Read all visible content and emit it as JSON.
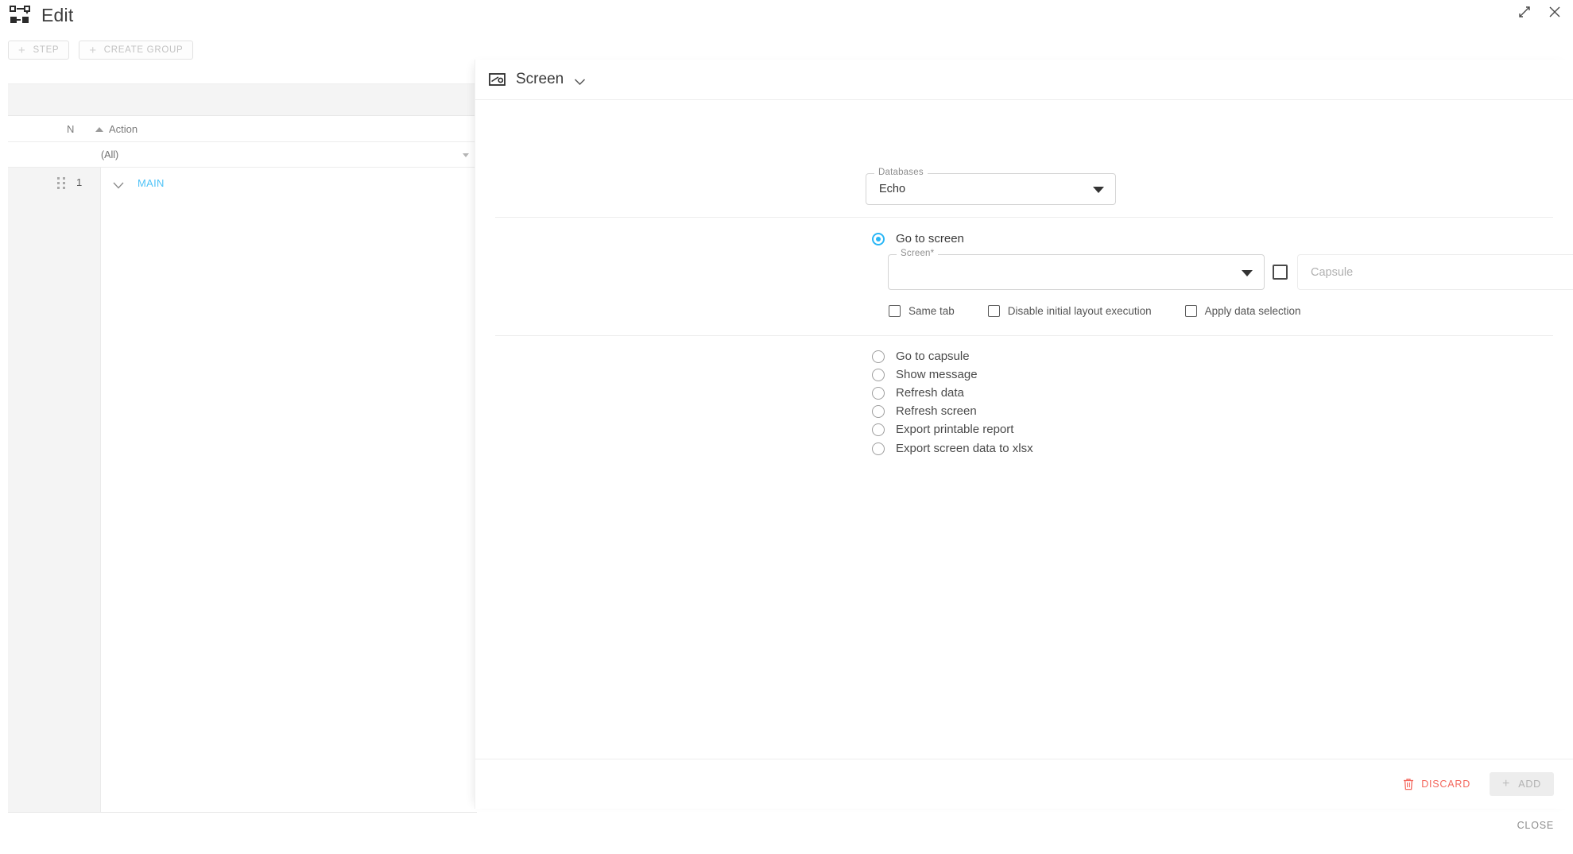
{
  "header": {
    "title": "Edit",
    "icon": "flow-diagram-icon",
    "expand_icon": "expand-icon",
    "close_icon": "close-icon"
  },
  "toolbar": {
    "step_label": "STEP",
    "create_group_label": "CREATE GROUP",
    "plus": "+"
  },
  "list": {
    "columns": {
      "n": "N",
      "action": "Action"
    },
    "filter_value": "(All)",
    "rows": [
      {
        "num": "1",
        "label": "MAIN",
        "label_color": "#4fc3f7"
      }
    ]
  },
  "detail": {
    "title": "Screen",
    "icon": "screen-icon",
    "databases": {
      "legend": "Databases",
      "value": "Echo"
    },
    "options": [
      {
        "id": "go-to-screen",
        "label": "Go to screen",
        "selected": true
      },
      {
        "id": "go-to-capsule",
        "label": "Go to capsule",
        "selected": false
      },
      {
        "id": "show-message",
        "label": "Show message",
        "selected": false
      },
      {
        "id": "refresh-data",
        "label": "Refresh data",
        "selected": false
      },
      {
        "id": "refresh-screen",
        "label": "Refresh screen",
        "selected": false
      },
      {
        "id": "export-printable-report",
        "label": "Export printable report",
        "selected": false
      },
      {
        "id": "export-screen-data-to-xlsx",
        "label": "Export screen data to xlsx",
        "selected": false
      }
    ],
    "screen_select": {
      "legend": "Screen*",
      "value": ""
    },
    "capsule_select": {
      "placeholder": "Capsule",
      "value": ""
    },
    "checkboxes": [
      {
        "id": "same-tab",
        "label": "Same tab",
        "checked": false
      },
      {
        "id": "disable-initial-layout-execution",
        "label": "Disable initial layout execution",
        "checked": false
      },
      {
        "id": "apply-data-selection",
        "label": "Apply data selection",
        "checked": false
      }
    ],
    "footer": {
      "discard_label": "DISCARD",
      "add_label": "ADD",
      "add_plus": "+",
      "trash_icon": "trash-icon"
    }
  },
  "close_label": "CLOSE",
  "colors": {
    "accent": "#29b6f6",
    "link": "#4fc3f7",
    "danger": "#f4685e"
  }
}
